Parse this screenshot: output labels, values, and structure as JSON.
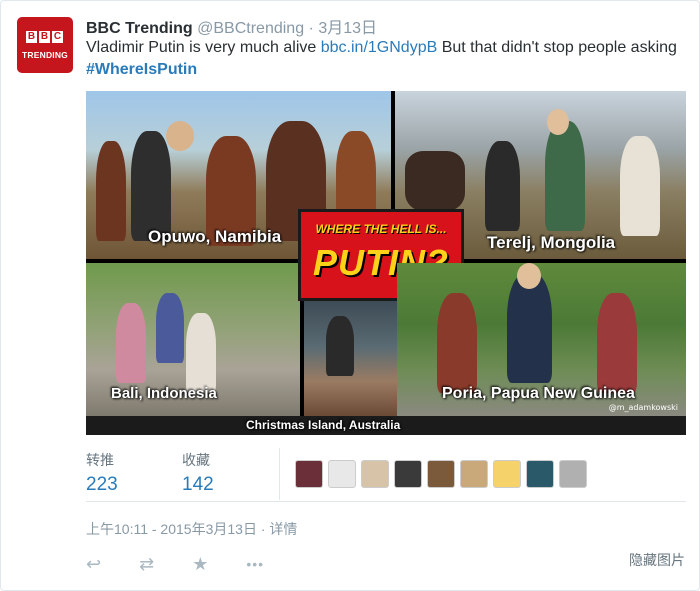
{
  "account": {
    "name": "BBC Trending",
    "handle": "@BBCtrending",
    "date_sep": " · ",
    "date": "3月13日",
    "avatar_letters": [
      "B",
      "B",
      "C"
    ],
    "avatar_text": "TRENDING"
  },
  "tweet": {
    "text_before": "Vladimir Putin is very much alive ",
    "link": "bbc.in/1GNdypB",
    "text_after": " But that didn't stop people asking ",
    "hashtag": "#WhereIsPutin"
  },
  "media": {
    "title_top": "WHERE THE HELL IS...",
    "title_main": "PUTIN?",
    "captions": {
      "opuwo": "Opuwo, Namibia",
      "terelj": "Terelj, Mongolia",
      "bali": "Bali, Indonesia",
      "christmas": "Christmas Island, Australia",
      "poria": "Poria, Papua New Guinea"
    },
    "credit": "@m_adamkowski"
  },
  "stats": {
    "retweets_label": "转推",
    "retweets_value": "223",
    "favorites_label": "收藏",
    "favorites_value": "142"
  },
  "faces": [
    "#6b2f3a",
    "#e8e8e8",
    "#d6c3a8",
    "#3a3a3a",
    "#7a5a3a",
    "#c9a87a",
    "#f5d36a",
    "#2a5a6a",
    "#b0b0b0"
  ],
  "timestamp": "上午10:11 - 2015年3月13日 · 详情",
  "hide_image": "隐藏图片",
  "actions": {
    "reply": "↩",
    "retweet": "⇄",
    "favorite": "★",
    "more": "•••"
  }
}
